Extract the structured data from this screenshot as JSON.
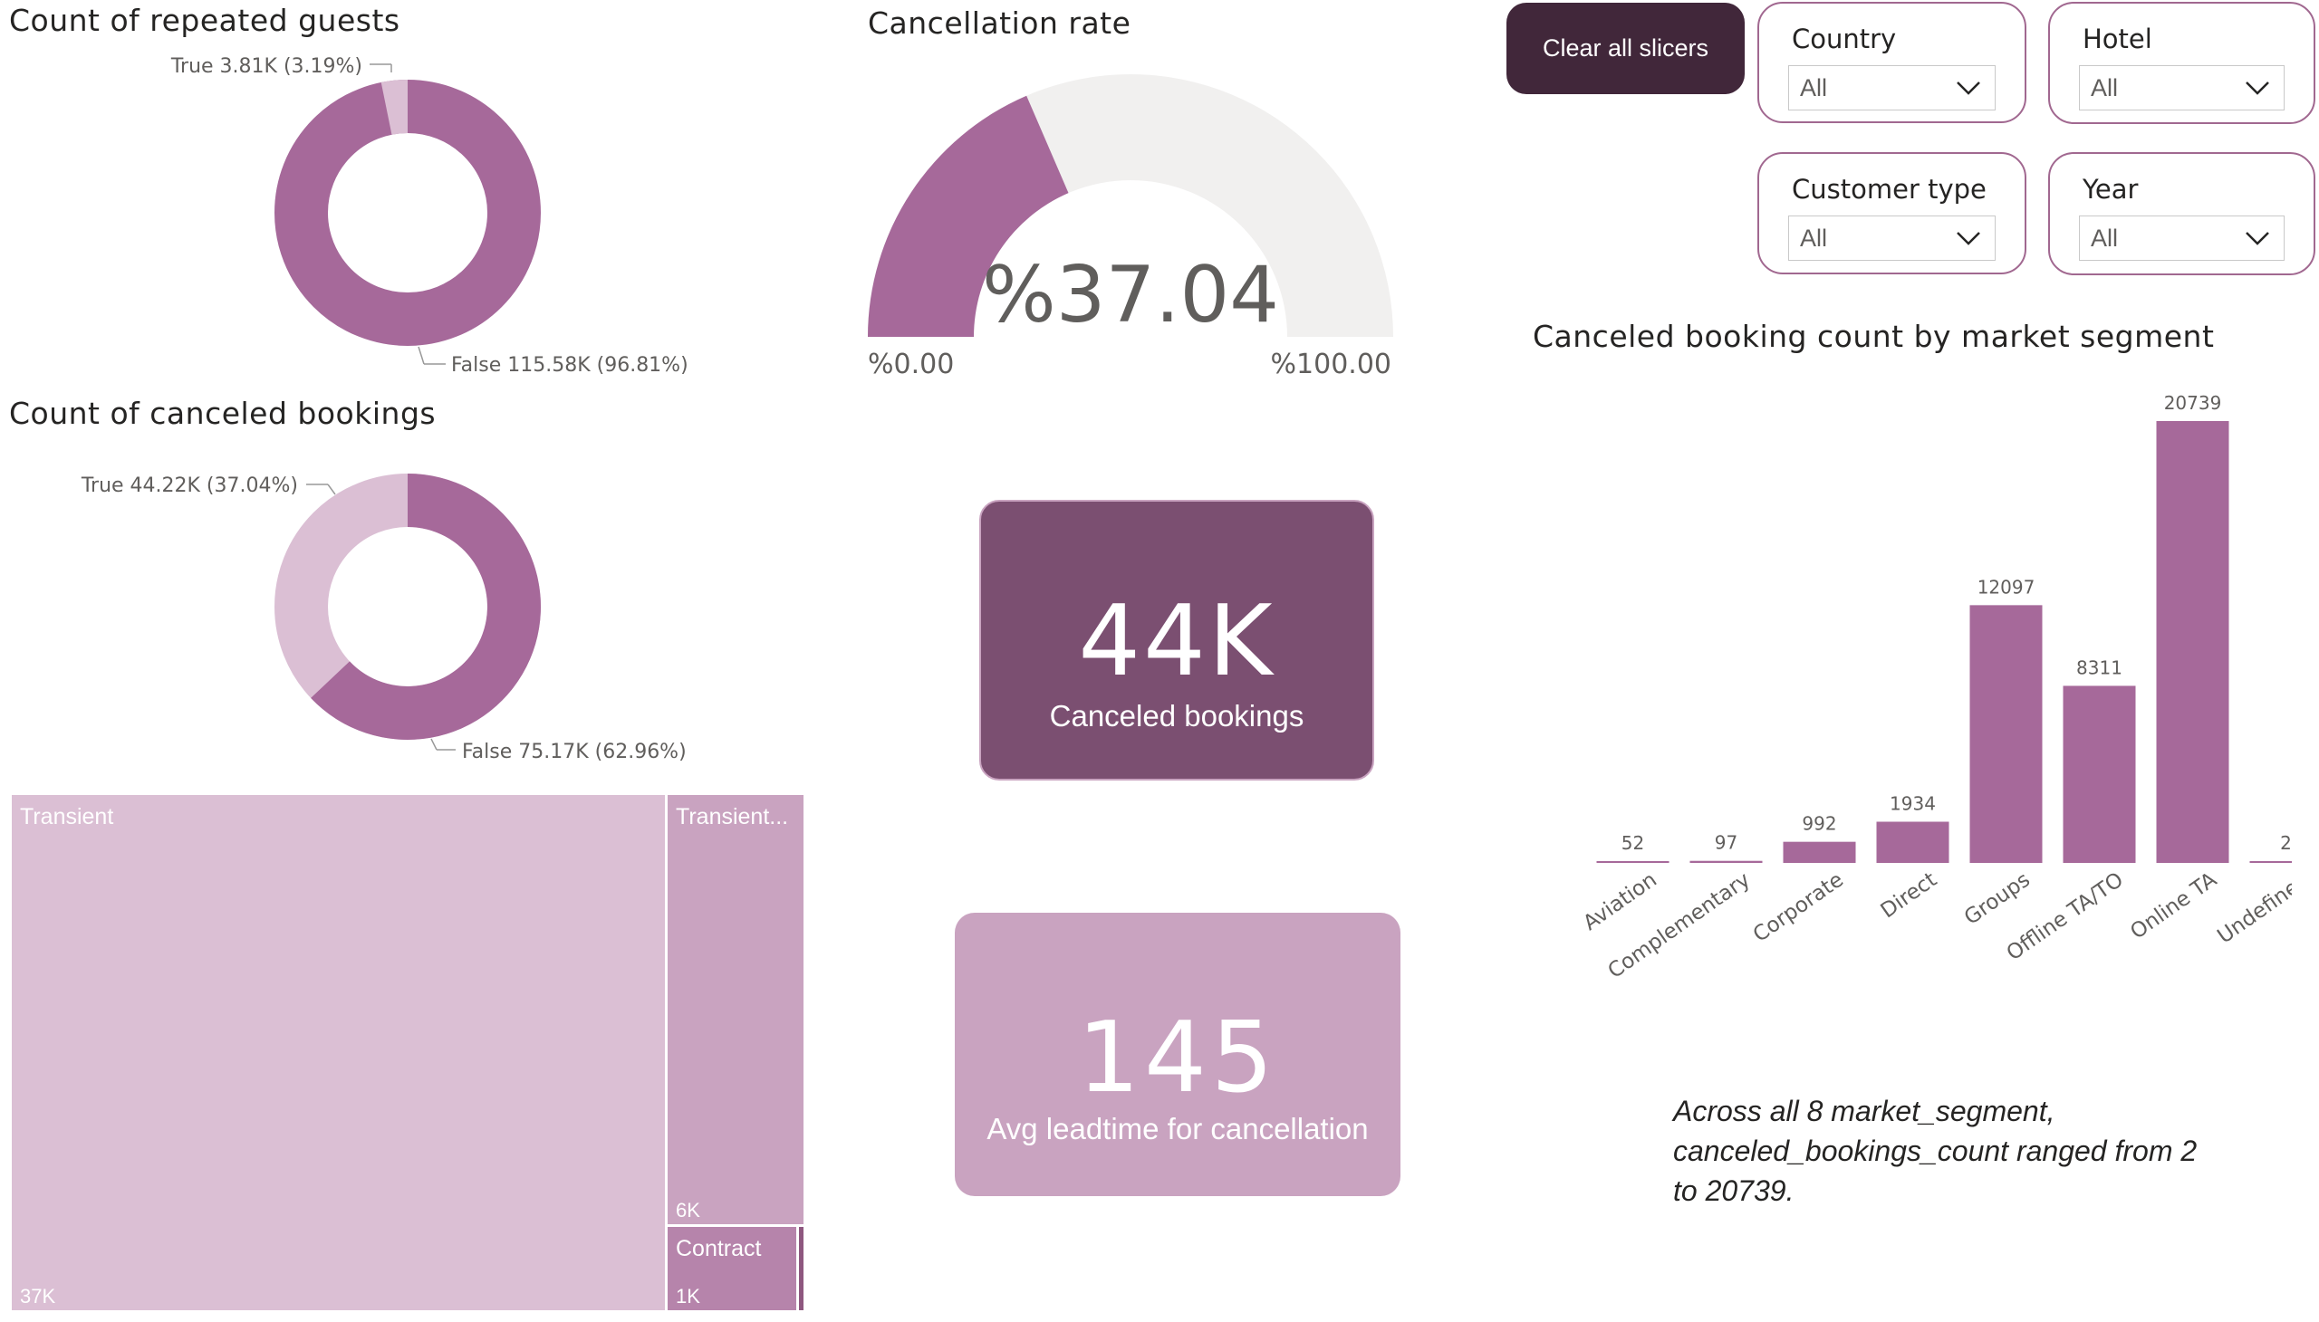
{
  "colors": {
    "primary": "#a6699a",
    "light": "#dbbfd4",
    "dark": "#41273a",
    "card_dark": "#7b4f71",
    "card_light": "#c9a3c0",
    "track": "#f1f0ef"
  },
  "repeated_guests": {
    "title": "Count of repeated guests",
    "true_label": "True 3.81K (3.19%)",
    "false_label": "False 115.58K (96.81%)",
    "true_pct": 3.19,
    "false_pct": 96.81
  },
  "canceled_bookings": {
    "title": "Count of canceled bookings",
    "true_label": "True 44.22K (37.04%)",
    "false_label": "False 75.17K (62.96%)",
    "true_pct": 37.04,
    "false_pct": 62.96
  },
  "cancellation_rate": {
    "title": "Cancellation rate",
    "value_label": "%37.04",
    "value": 37.04,
    "min_label": "%0.00",
    "max_label": "%100.00"
  },
  "slicers": {
    "clear_label": "Clear all slicers",
    "country": {
      "label": "Country",
      "value": "All"
    },
    "hotel": {
      "label": "Hotel",
      "value": "All"
    },
    "customer_type": {
      "label": "Customer type",
      "value": "All"
    },
    "year": {
      "label": "Year",
      "value": "All"
    }
  },
  "cards": {
    "canceled": {
      "value": "44K",
      "label": "Canceled bookings"
    },
    "leadtime": {
      "value": "145",
      "label": "Avg leadtime for cancellation"
    }
  },
  "treemap": {
    "transient": {
      "label": "Transient",
      "value": "37K"
    },
    "transient_party": {
      "label": "Transient...",
      "value": "6K"
    },
    "contract": {
      "label": "Contract",
      "value": "1K"
    }
  },
  "chart_data": {
    "type": "bar",
    "title": "Canceled booking count by market segment",
    "categories": [
      "Aviation",
      "Complementary",
      "Corporate",
      "Direct",
      "Groups",
      "Offline TA/TO",
      "Online TA",
      "Undefined"
    ],
    "values": [
      52,
      97,
      992,
      1934,
      12097,
      8311,
      20739,
      2
    ],
    "xlabel": "",
    "ylabel": "",
    "ylim": [
      0,
      20739
    ],
    "grid": false
  },
  "narrative": "Across all 8 market_segment, canceled_bookings_count ranged from 2 to 20739."
}
